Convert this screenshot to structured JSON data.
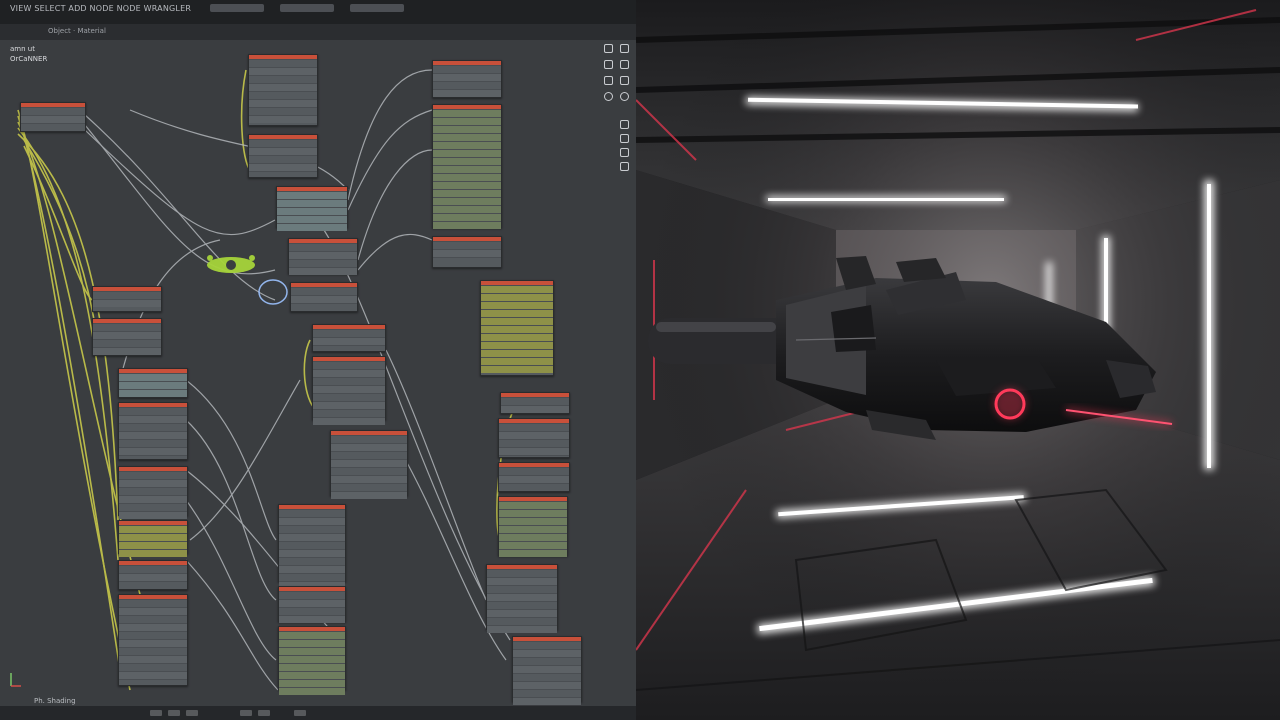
{
  "editor": {
    "title": "VIEW  SELECT  ADD  NODE  NODE WRANGLER",
    "subtitle": "Object  ·  Material",
    "left_labels": [
      "amn ut",
      "OrCaNNER"
    ],
    "footer_text": "Ph. Shading",
    "colors": {
      "background": "#3a3d40",
      "node_header": "#c8503a",
      "wire_yellow": "#c7c84a",
      "wire_gray": "#b1b5b9",
      "wire_blue": "#9cc2ff"
    }
  },
  "toolbar": {
    "icons": [
      "view-icon",
      "snap-icon",
      "overlay-icon",
      "shading-icon",
      "render-icon",
      "camera-icon",
      "grid-icon",
      "lock-icon"
    ]
  },
  "viewport": {
    "subject": "spaceship",
    "accent_color": "#ff3a5a"
  }
}
